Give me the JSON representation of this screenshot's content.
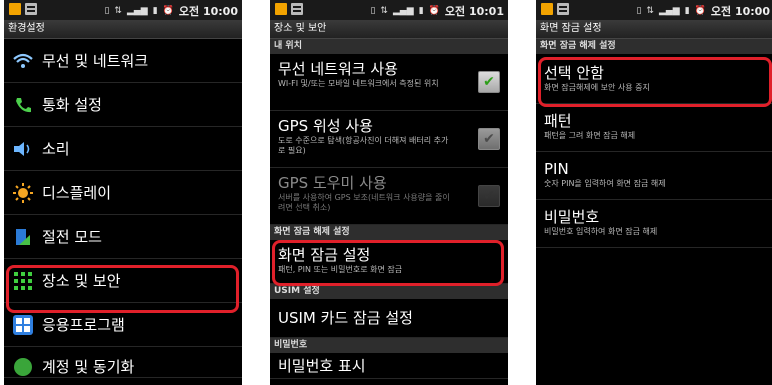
{
  "status": {
    "screen1_time": "오전 10:00",
    "screen2_time": "오전 10:01",
    "screen3_time": "오전 10:00"
  },
  "screen1": {
    "title": "환경설정",
    "items": [
      {
        "label": "무선 및 네트워크",
        "icon": "wifi-icon"
      },
      {
        "label": "통화 설정",
        "icon": "phone-icon"
      },
      {
        "label": "소리",
        "icon": "speaker-icon"
      },
      {
        "label": "디스플레이",
        "icon": "brightness-icon"
      },
      {
        "label": "절전 모드",
        "icon": "power-saving-icon"
      },
      {
        "label": "장소 및 보안",
        "icon": "location-security-icon"
      },
      {
        "label": "응용프로그램",
        "icon": "apps-icon"
      },
      {
        "label": "계정 및 동기화",
        "icon": "sync-icon"
      }
    ]
  },
  "screen2": {
    "title": "장소 및 보안",
    "section_location": "내 위치",
    "wireless": {
      "title": "무선 네트워크 사용",
      "sub": "WI-FI 및/또는 모바일 네트워크에서 측정된 위치"
    },
    "gps": {
      "title": "GPS 위성 사용",
      "sub": "도로 수준으로 탐색(항공사진이 더해져 배터리 추가로 필요)"
    },
    "gps_assist": {
      "title": "GPS 도우미 사용",
      "sub": "서버를 사용하여 GPS 보조(네트워크 사용량을 줄이려면 선택 취소)"
    },
    "section_unlock": "화면 잠금 해제 설정",
    "screen_lock": {
      "title": "화면 잠금 설정",
      "sub": "패턴, PIN 또는 비밀번호로 화면 잠금"
    },
    "section_usim": "USIM 설정",
    "usim_lock": {
      "title": "USIM 카드 잠금 설정"
    },
    "section_password": "비밀번호",
    "password_visible": {
      "title": "비밀번호 표시"
    }
  },
  "screen3": {
    "title": "화면 잠금 설정",
    "section": "화면 잠금 해제 설정",
    "options": [
      {
        "title": "선택 안함",
        "sub": "화면 잠금해제에 보안 사용 중지"
      },
      {
        "title": "패턴",
        "sub": "패턴을 그려 화면 잠금 해제"
      },
      {
        "title": "PIN",
        "sub": "숫자 PIN을 입력하여 화면 잠금 해제"
      },
      {
        "title": "비밀번호",
        "sub": "비밀번호 입력하여 화면 잠금 해제"
      }
    ]
  },
  "colors": {
    "highlight": "#e0202a",
    "check_green": "#2e9e1a"
  }
}
